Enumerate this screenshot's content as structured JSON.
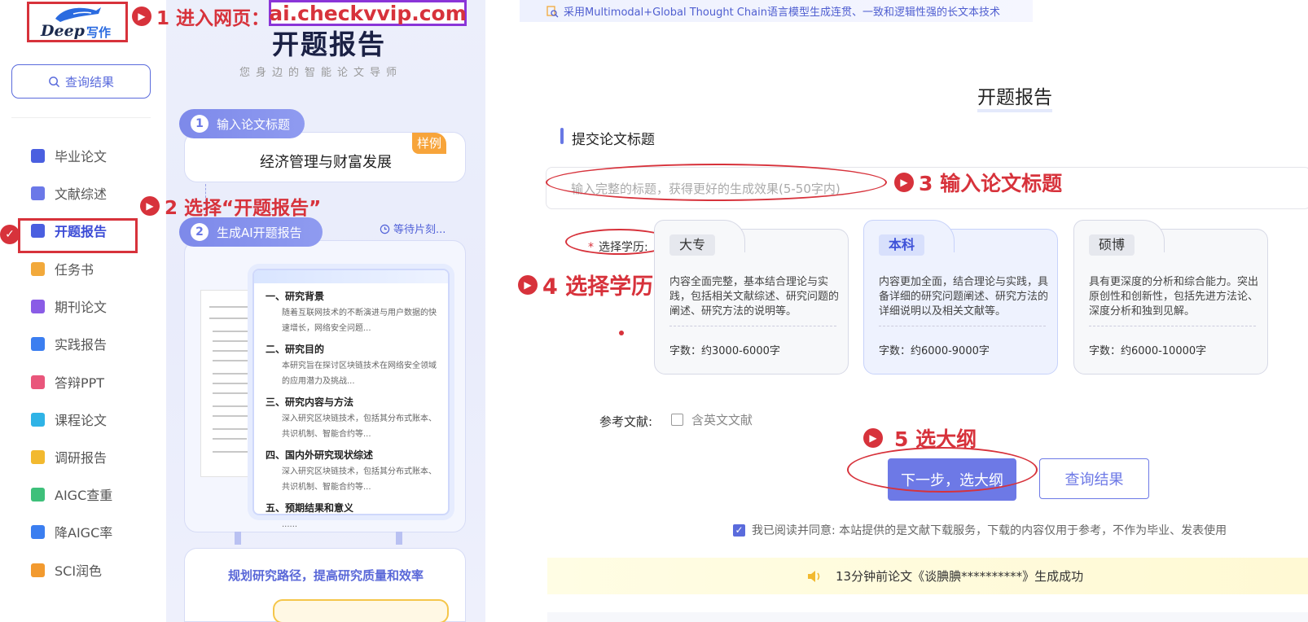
{
  "logo": {
    "text": "Deep",
    "cn": "写作"
  },
  "sidebar": {
    "query_label": "查询结果",
    "items": [
      {
        "label": "毕业论文",
        "icon": "graduation-cap-icon",
        "color": "#4a5fe0"
      },
      {
        "label": "文献综述",
        "icon": "document-icon",
        "color": "#6b78e8"
      },
      {
        "label": "开题报告",
        "icon": "report-icon",
        "color": "#4a5fe0",
        "active": true
      },
      {
        "label": "任务书",
        "icon": "task-icon",
        "color": "#f2a93b"
      },
      {
        "label": "期刊论文",
        "icon": "journal-icon",
        "color": "#8a5ce6"
      },
      {
        "label": "实践报告",
        "icon": "practice-icon",
        "color": "#3b7ef0"
      },
      {
        "label": "答辩PPT",
        "icon": "ppt-icon",
        "color": "#e9567b"
      },
      {
        "label": "课程论文",
        "icon": "course-icon",
        "color": "#2fb3e6"
      },
      {
        "label": "调研报告",
        "icon": "survey-icon",
        "color": "#f2b92f"
      },
      {
        "label": "AIGC查重",
        "icon": "aigc-check-icon",
        "color": "#3ec07a"
      },
      {
        "label": "降AIGC率",
        "icon": "aigc-reduce-icon",
        "color": "#3b7ef0"
      },
      {
        "label": "SCI润色",
        "icon": "sci-icon",
        "color": "#f29a2f"
      }
    ]
  },
  "middle": {
    "title": "开题报告",
    "subtitle": "您身边的智能论文导师",
    "step1": {
      "num": "1",
      "label": "输入论文标题",
      "sample": "样例",
      "example": "经济管理与财富发展"
    },
    "step2": {
      "num": "2",
      "label": "生成AI开题报告",
      "waiting": "等待片刻..."
    },
    "doc": [
      {
        "heading": "一、研究背景",
        "body": "随着互联网技术的不断演进与用户数据的快速增长，网络安全问题..."
      },
      {
        "heading": "二、研究目的",
        "body": "本研究旨在探讨区块链技术在网络安全领域的应用潜力及挑战..."
      },
      {
        "heading": "三、研究内容与方法",
        "body": "深入研究区块链技术，包括其分布式账本、共识机制、智能合约等..."
      },
      {
        "heading": "四、国内外研究现状综述",
        "body": "深入研究区块链技术，包括其分布式账本、共识机制、智能合约等..."
      },
      {
        "heading": "五、预期结果和意义",
        "body": "......"
      }
    ],
    "bottom_text": "规划研究路径，提高研究质量和效率"
  },
  "annotations": {
    "a1_prefix": "1 进入网页：",
    "a1_url": "ai.checkvvip.com",
    "a2": "2 选择“开题报告”",
    "a3": "3 输入论文标题",
    "a4": "4 选择学历",
    "a5": "5 选大纲"
  },
  "main": {
    "banner": "采用Multimodal+Global Thought Chain语言模型生成连贯、一致和逻辑性强的长文本技术",
    "title": "开题报告",
    "section_title": "提交论文标题",
    "input_placeholder": "输入完整的标题，获得更好的生成效果(5-50字内)",
    "edu_label": "选择学历:",
    "edu_required": "*",
    "cards": [
      {
        "name": "大专",
        "desc": "内容全面完整，基本结合理论与实践，包括相关文献综述、研究问题的阐述、研究方法的说明等。",
        "count": "字数：约3000-6000字",
        "selected": false
      },
      {
        "name": "本科",
        "desc": "内容更加全面，结合理论与实践，具备详细的研究问题阐述、研究方法的详细说明以及相关文献等。",
        "count": "字数：约6000-9000字",
        "selected": true
      },
      {
        "name": "硕博",
        "desc": "具有更深度的分析和综合能力。突出原创性和创新性，包括先进方法论、深度分析和独到见解。",
        "count": "字数：约6000-10000字",
        "selected": false
      }
    ],
    "ref_label": "参考文献:",
    "ref_option": "含英文文献",
    "ref_checked": false,
    "next_label": "下一步，选大纲",
    "query_label": "查询结果",
    "agree_text": "我已阅读并同意: 本站提供的是文献下载服务，下载的内容仅用于参考，不作为毕业、发表使用",
    "agree_checked": true,
    "notice": "13分钟前论文《谈腆腆**********》生成成功"
  },
  "colors": {
    "accent": "#6d79e6",
    "annotation": "#d7323b",
    "url_border": "#8a35d8"
  }
}
